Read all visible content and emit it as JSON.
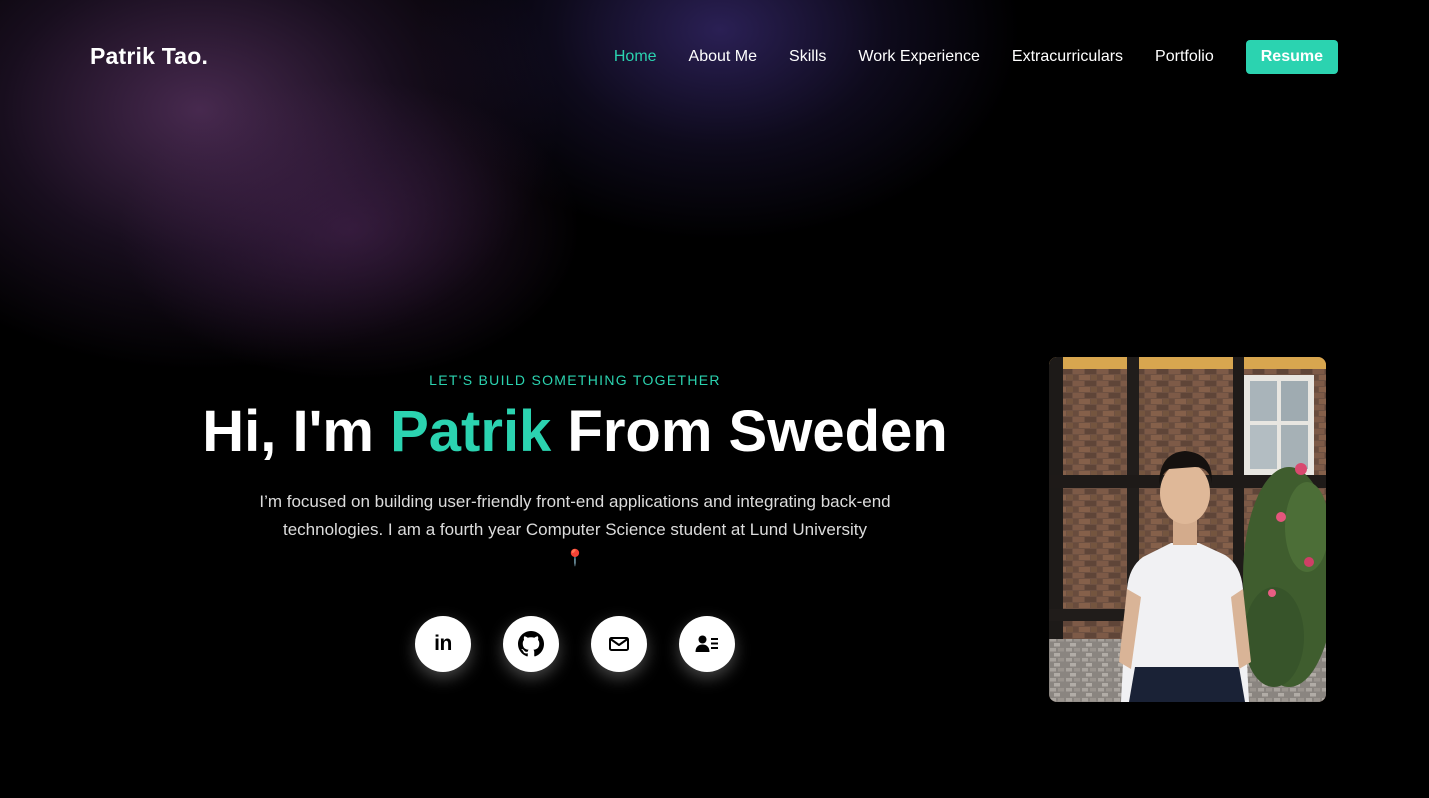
{
  "brand": "Patrik Tao.",
  "nav": {
    "links": [
      "Home",
      "About Me",
      "Skills",
      "Work Experience",
      "Extracurriculars",
      "Portfolio"
    ],
    "active": "Home",
    "resume_label": "Resume"
  },
  "hero": {
    "eyebrow": "LET'S BUILD SOMETHING TOGETHER",
    "headline_prefix": "Hi, I'm ",
    "headline_name": "Patrik",
    "headline_suffix": " From Sweden",
    "bio": "I’m focused on building user-friendly front-end applications and integrating back-end technologies. I am a fourth year Computer Science student at Lund University",
    "bio_pin": "📍"
  },
  "socials": [
    {
      "name": "linkedin-icon",
      "text": "in"
    },
    {
      "name": "github-icon"
    },
    {
      "name": "mail-icon"
    },
    {
      "name": "contact-card-icon"
    }
  ],
  "colors": {
    "accent": "#2bd3b0",
    "background": "#000000",
    "text": "#ffffff",
    "bio_text": "#dcdcdc"
  }
}
